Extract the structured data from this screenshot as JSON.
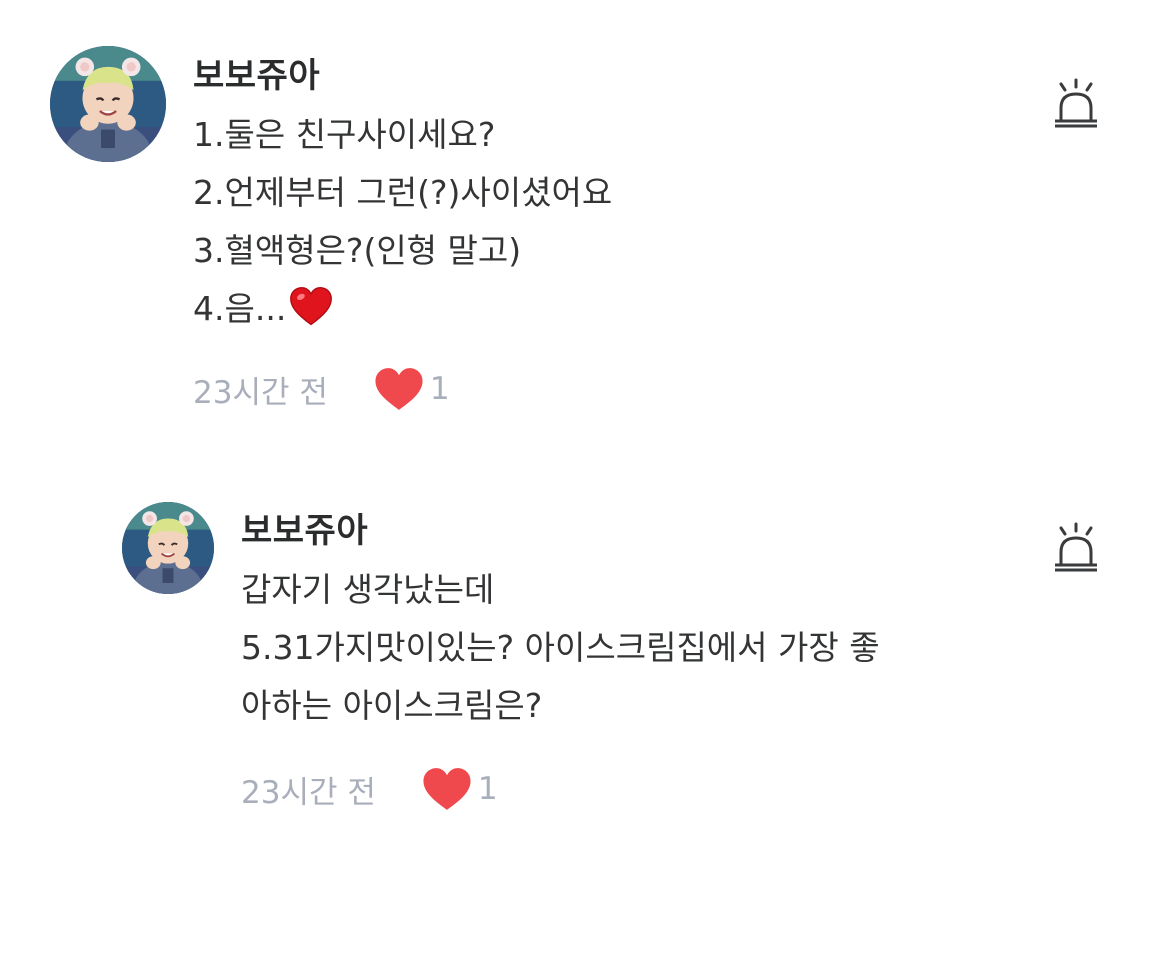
{
  "comments": [
    {
      "author": "보보쥬아",
      "lines": [
        "1.둘은 친구사이세요?",
        "2.언제부터 그런(?)사이셨어요",
        "3.혈액형은?(인형 말고)",
        "4.음..."
      ],
      "line_emoji": "❤️",
      "timestamp": "23시간 전",
      "likes": "1",
      "avatar_icon": "profile-photo",
      "report_icon": "siren-icon"
    },
    {
      "author": "보보쥬아",
      "lines": [
        "갑자기 생각났는데",
        "5.31가지맛이있는? 아이스크림집에서 가장 좋",
        "아하는 아이스크림은?"
      ],
      "timestamp": "23시간 전",
      "likes": "1",
      "avatar_icon": "profile-photo",
      "report_icon": "siren-icon"
    }
  ],
  "colors": {
    "text": "#333436",
    "author": "#2b2c2e",
    "meta": "#a9aebb",
    "heart": "#f0494d",
    "icon": "#3a3b3d"
  }
}
